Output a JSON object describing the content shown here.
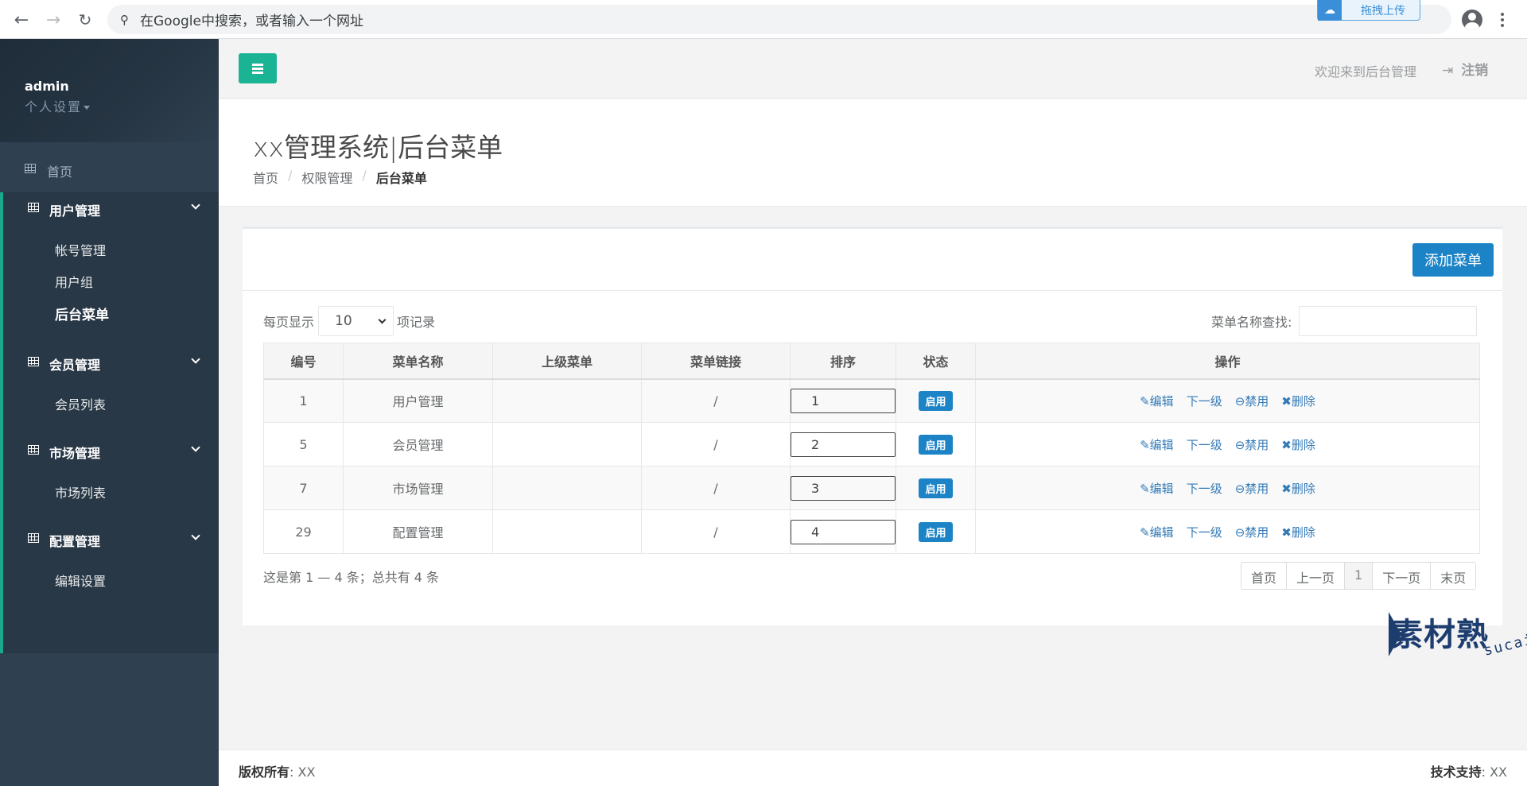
{
  "browser": {
    "omnibox_placeholder": "在Google中搜索，或者输入一个网址",
    "upload_label": "拖拽上传"
  },
  "sidebar": {
    "username": "admin",
    "settings_label": "个人设置",
    "home_label": "首页",
    "groups": [
      {
        "label": "用户管理",
        "items": [
          "帐号管理",
          "用户组",
          "后台菜单"
        ]
      },
      {
        "label": "会员管理",
        "items": [
          "会员列表"
        ]
      },
      {
        "label": "市场管理",
        "items": [
          "市场列表"
        ]
      },
      {
        "label": "配置管理",
        "items": [
          "编辑设置"
        ]
      }
    ],
    "current_item": "后台菜单"
  },
  "topnav": {
    "welcome": "欢迎来到后台管理",
    "logout": "注销"
  },
  "heading": {
    "title": "xx管理系统|后台菜单",
    "breadcrumb": [
      "首页",
      "权限管理",
      "后台菜单"
    ]
  },
  "panel": {
    "add_button": "添加菜单",
    "length_before": "每页显示",
    "length_value": "10",
    "length_after": "项记录",
    "search_label": "菜单名称查找:",
    "columns": [
      "编号",
      "菜单名称",
      "上级菜单",
      "菜单链接",
      "排序",
      "状态",
      "操作"
    ],
    "rows": [
      {
        "id": "1",
        "name": "用户管理",
        "parent": "",
        "link": "/",
        "sort": "1",
        "status": "启用"
      },
      {
        "id": "5",
        "name": "会员管理",
        "parent": "",
        "link": "/",
        "sort": "2",
        "status": "启用"
      },
      {
        "id": "7",
        "name": "市场管理",
        "parent": "",
        "link": "/",
        "sort": "3",
        "status": "启用"
      },
      {
        "id": "29",
        "name": "配置管理",
        "parent": "",
        "link": "/",
        "sort": "4",
        "status": "启用"
      }
    ],
    "actions": {
      "edit": "编辑",
      "child": "下一级",
      "disable": "禁用",
      "delete": "删除"
    },
    "info": "这是第 1 — 4 条；总共有 4 条",
    "pager": [
      "首页",
      "上一页",
      "1",
      "下一页",
      "末页"
    ]
  },
  "footer": {
    "left_label": "版权所有",
    "left_value": ": XX",
    "right_label": "技术支持",
    "right_value": ": XX"
  },
  "watermark": {
    "cn": "素材熟",
    "en": "sucaire.com"
  },
  "colors": {
    "sidebar": "#2f4050",
    "accent": "#1ab394",
    "primary": "#1c84c6"
  }
}
